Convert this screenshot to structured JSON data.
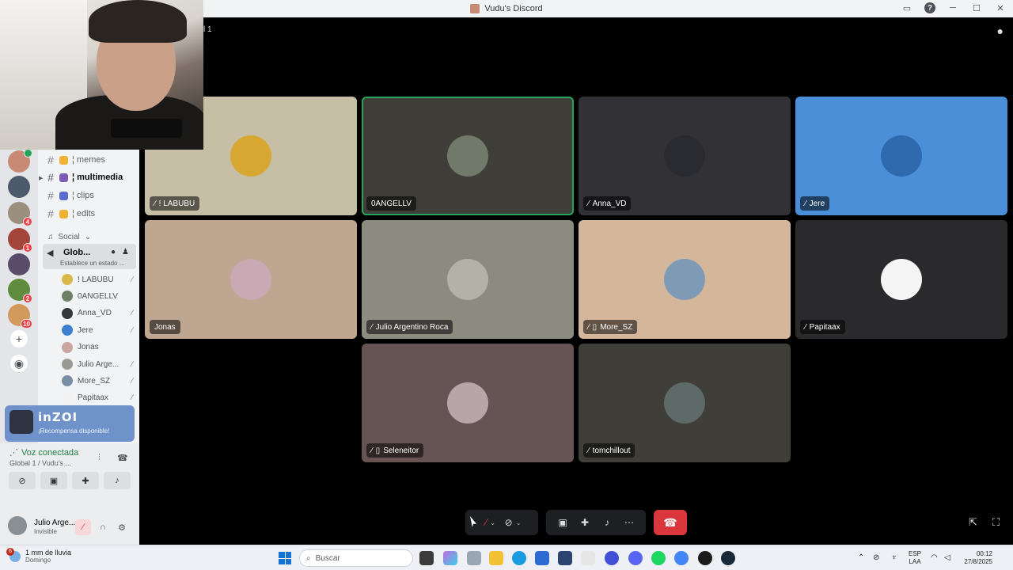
{
  "window": {
    "title": "Vudu's Discord"
  },
  "stage_header": {
    "partial_label": "l 1"
  },
  "channels": [
    {
      "name": "¦ memes",
      "bold": false
    },
    {
      "name": "¦ multimedia",
      "bold": true
    },
    {
      "name": "¦ clips",
      "bold": false
    },
    {
      "name": "¦ edits",
      "bold": false
    }
  ],
  "category": {
    "label": "Social"
  },
  "active_voice": {
    "name": "Glob...",
    "status": "Establece un estado ..."
  },
  "voice_members": [
    {
      "name": "! LABUBU",
      "muted": true,
      "color": "#d9b84a"
    },
    {
      "name": "0ANGELLV",
      "muted": false,
      "color": "#6f7f66"
    },
    {
      "name": "Anna_VD",
      "muted": true,
      "color": "#35373c"
    },
    {
      "name": "Jere",
      "muted": true,
      "color": "#3d7fd1"
    },
    {
      "name": "Jonas",
      "muted": false,
      "color": "#c9a7a0"
    },
    {
      "name": "Julio Arge...",
      "muted": true,
      "color": "#9a9a92"
    },
    {
      "name": "More_SZ",
      "muted": true,
      "color": "#7a8fa5"
    },
    {
      "name": "Papitaax",
      "muted": true,
      "color": "#f2f2f2"
    },
    {
      "name": "Seleneitor",
      "muted": true,
      "color": "#8e7470"
    }
  ],
  "promo": {
    "brand": "inZOI",
    "subtitle": "¡Recompensa disponible!"
  },
  "voice_panel": {
    "state": "Voz conectada",
    "location": "Global 1 / Vudu's ..."
  },
  "user": {
    "name": "Julio Arge...",
    "status": "Invisible"
  },
  "rail_badges": [
    "4",
    "1",
    "2",
    "10"
  ],
  "tiles": [
    {
      "name": "! LABUBU",
      "bg": "#c6bfa6",
      "avatar": "#d8a731",
      "muted": true,
      "phone": false,
      "speaking": false
    },
    {
      "name": "0ANGELLV",
      "bg": "#3f3e39",
      "avatar": "#70796a",
      "muted": false,
      "phone": false,
      "speaking": true
    },
    {
      "name": "Anna_VD",
      "bg": "#323236",
      "avatar": "#2a2b30",
      "muted": true,
      "phone": false,
      "speaking": false
    },
    {
      "name": "Jere",
      "bg": "#4a8fd7",
      "avatar": "#2f69ae",
      "muted": true,
      "phone": false,
      "speaking": false
    },
    {
      "name": "Jonas",
      "bg": "#bea691",
      "avatar": "#c9a9b4",
      "muted": false,
      "phone": false,
      "speaking": false
    },
    {
      "name": "Julio Argentino Roca",
      "bg": "#8c8b80",
      "avatar": "#b4b1a6",
      "muted": true,
      "phone": false,
      "speaking": false
    },
    {
      "name": "More_SZ",
      "bg": "#d4b69b",
      "avatar": "#7f9ab5",
      "muted": true,
      "phone": true,
      "speaking": false
    },
    {
      "name": "Papitaax",
      "bg": "#2a2a2c",
      "avatar": "#f5f5f5",
      "muted": true,
      "phone": false,
      "speaking": false
    },
    {
      "name": "Seleneitor",
      "bg": "#665354",
      "avatar": "#b7a5a7",
      "muted": true,
      "phone": true,
      "speaking": false
    },
    {
      "name": "tomchillout",
      "bg": "#3f3e39",
      "avatar": "#5d6a68",
      "muted": true,
      "phone": false,
      "speaking": false
    }
  ],
  "taskbar": {
    "weather_line1": "1 mm de lluvia",
    "weather_line2": "Domingo",
    "weather_badge": "6",
    "search_placeholder": "Buscar",
    "lang_line1": "ESP",
    "lang_line2": "LAA",
    "time": "00:12",
    "date": "27/8/2025"
  },
  "icons": {
    "hash": "#",
    "mute": "⁄",
    "phone": "▯",
    "speaker": "🔈",
    "hangup": "☎"
  }
}
